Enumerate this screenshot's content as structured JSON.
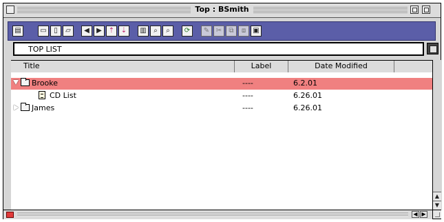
{
  "window": {
    "title": "Top : BSmith"
  },
  "toolbar": {
    "buttons": [
      {
        "icon": "menu-icon",
        "glyph": "▤"
      },
      {
        "icon": "folder-new-icon",
        "glyph": "▭"
      },
      {
        "icon": "document-new-icon",
        "glyph": "▯"
      },
      {
        "icon": "folder-open-icon",
        "glyph": "▱"
      },
      {
        "icon": "arrow-left-icon",
        "glyph": "◀"
      },
      {
        "icon": "arrow-right-icon",
        "glyph": "▶"
      },
      {
        "icon": "move-up-icon",
        "glyph": "⇡"
      },
      {
        "icon": "move-down-icon",
        "glyph": "⇣"
      },
      {
        "icon": "trash-icon",
        "glyph": "🗑"
      },
      {
        "icon": "find-icon",
        "glyph": "⌕"
      },
      {
        "icon": "find-next-icon",
        "glyph": "⌕"
      },
      {
        "icon": "refresh-icon",
        "glyph": "⟳"
      },
      {
        "icon": "edit-icon",
        "glyph": "✎"
      },
      {
        "icon": "cut-icon",
        "glyph": "✂"
      },
      {
        "icon": "copy-icon",
        "glyph": "⧉"
      },
      {
        "icon": "paste-icon",
        "glyph": "⧈"
      },
      {
        "icon": "clipboard-icon",
        "glyph": "▣"
      }
    ]
  },
  "path": {
    "label": "TOP LIST"
  },
  "columns": {
    "title": "Title",
    "label": "Label",
    "date_modified": "Date Modified"
  },
  "rows": [
    {
      "name": "Brooke",
      "label": "----",
      "date": "6.2.01"
    },
    {
      "name": "CD List",
      "label": "----",
      "date": "6.26.01"
    },
    {
      "name": "James",
      "label": "----",
      "date": "6.26.01"
    }
  ],
  "colors": {
    "selected_row": "#f08080",
    "toolbar": "#5b5ea8"
  }
}
